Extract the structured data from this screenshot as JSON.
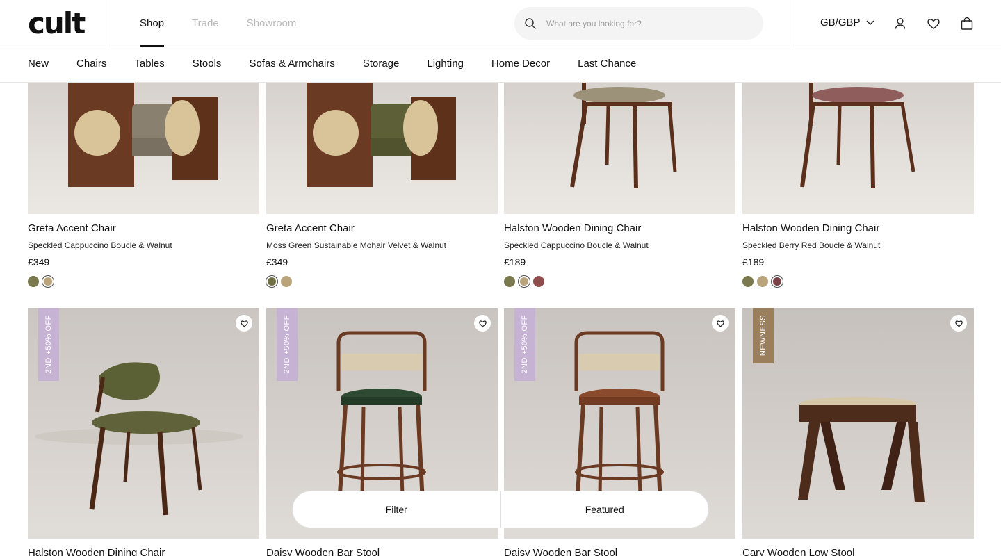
{
  "header": {
    "logo": "cult",
    "tabs": [
      {
        "label": "Shop",
        "active": true
      },
      {
        "label": "Trade",
        "active": false
      },
      {
        "label": "Showroom",
        "active": false
      }
    ],
    "search_placeholder": "What are you looking for?",
    "currency": "GB/GBP",
    "icons": [
      "search-icon",
      "chevron-down-icon",
      "account-icon",
      "wishlist-heart-icon",
      "shopping-bag-icon"
    ]
  },
  "categories": [
    "New",
    "Chairs",
    "Tables",
    "Stools",
    "Sofas & Armchairs",
    "Storage",
    "Lighting",
    "Home Decor",
    "Last Chance"
  ],
  "products_row1": [
    {
      "title": "Greta Accent Chair",
      "subtitle": "Speckled Cappuccino Boucle & Walnut",
      "price": "£349",
      "swatches": [
        "#7a7a4e",
        "#b9a47c"
      ],
      "selected_swatch": 1
    },
    {
      "title": "Greta Accent Chair",
      "subtitle": "Moss Green Sustainable Mohair Velvet & Walnut",
      "price": "£349",
      "swatches": [
        "#6f7044",
        "#b9a47c"
      ],
      "selected_swatch": 0
    },
    {
      "title": "Halston Wooden Dining Chair",
      "subtitle": "Speckled Cappuccino Boucle & Walnut",
      "price": "£189",
      "swatches": [
        "#7a7a4e",
        "#b9a47c",
        "#8e4c4c"
      ],
      "selected_swatch": 1
    },
    {
      "title": "Halston Wooden Dining Chair",
      "subtitle": "Speckled Berry Red Boucle & Walnut",
      "price": "£189",
      "swatches": [
        "#7a7a4e",
        "#b9a47c",
        "#7a4247"
      ],
      "selected_swatch": 2
    }
  ],
  "products_row2": [
    {
      "title": "Halston Wooden Dining Chair",
      "badge": "2ND +50% OFF"
    },
    {
      "title": "Daisy Wooden Bar Stool",
      "badge": "2ND +50% OFF"
    },
    {
      "title": "Daisy Wooden Bar Stool",
      "badge": "2ND +50% OFF"
    },
    {
      "title": "Cary Wooden Low Stool",
      "badge": "NEWNESS"
    }
  ],
  "filterbar": {
    "filter_label": "Filter",
    "sort_label": "Featured"
  },
  "colors": {
    "promo_badge": "#c6b2d3",
    "new_badge": "#9b7f5d",
    "walnut": "#5a2f1c"
  }
}
